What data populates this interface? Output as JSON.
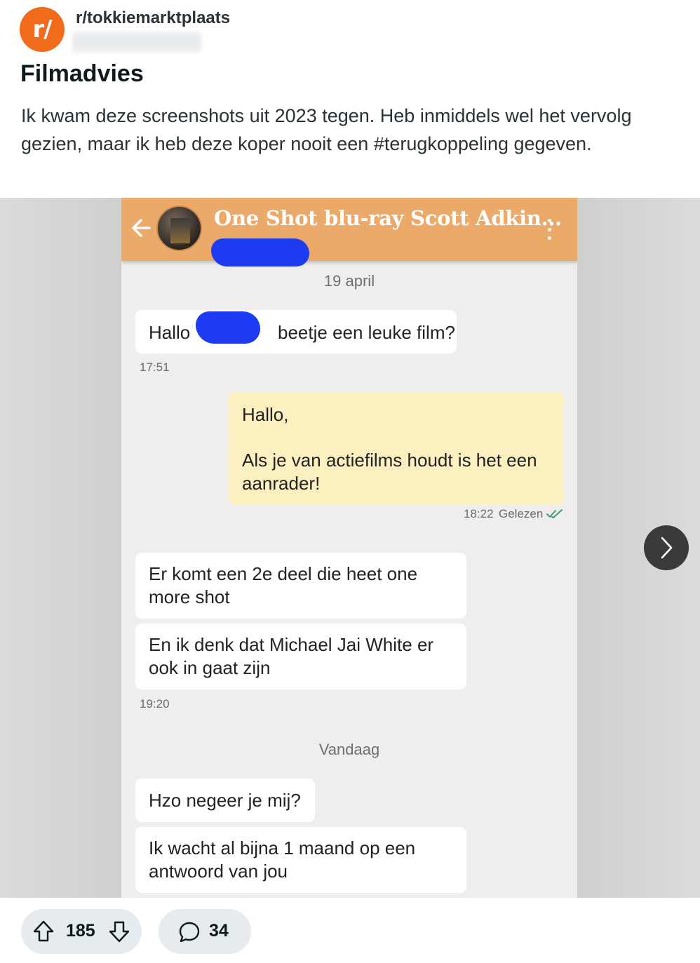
{
  "post": {
    "subreddit": "r/tokkiemarktplaats",
    "subreddit_icon": "r/",
    "title": "Filmadvies",
    "body": "Ik kwam deze screenshots uit 2023 tegen. Heb inmiddels wel het vervolg gezien, maar ik heb deze koper nooit een #terugkoppeling gegeven."
  },
  "chat": {
    "title": "One Shot blu-ray Scott Adkin...",
    "header_color": "#ebaa6a",
    "messages": [
      {
        "day": "19 april"
      },
      {
        "direction": "in",
        "text_before": "Hallo",
        "text_after": "beetje een leuke film?",
        "time": "17:51"
      },
      {
        "direction": "out",
        "lines": [
          "Hallo,",
          "Als je van actiefilms houdt is het een aanrader!"
        ],
        "time": "18:22",
        "status": "Gelezen"
      },
      {
        "direction": "in",
        "text": "Er komt een 2e deel die heet one more shot"
      },
      {
        "direction": "in",
        "text": "En ik denk dat Michael Jai White er ook in gaat zijn",
        "time": "19:20"
      },
      {
        "day": "Vandaag"
      },
      {
        "direction": "in",
        "text": "Hzo negeer je mij?"
      },
      {
        "direction": "in",
        "text": "Ik wacht al bijna 1 maand op een antwoord van jou"
      }
    ]
  },
  "actions": {
    "upvotes": "185",
    "comments": "34"
  },
  "icons": {
    "back": "arrow-left-icon",
    "menu": "kebab-menu-icon",
    "next": "chevron-right-icon",
    "upvote": "upvote-arrow-icon",
    "downvote": "downvote-arrow-icon",
    "comment": "comment-bubble-icon",
    "read": "double-check-icon"
  }
}
